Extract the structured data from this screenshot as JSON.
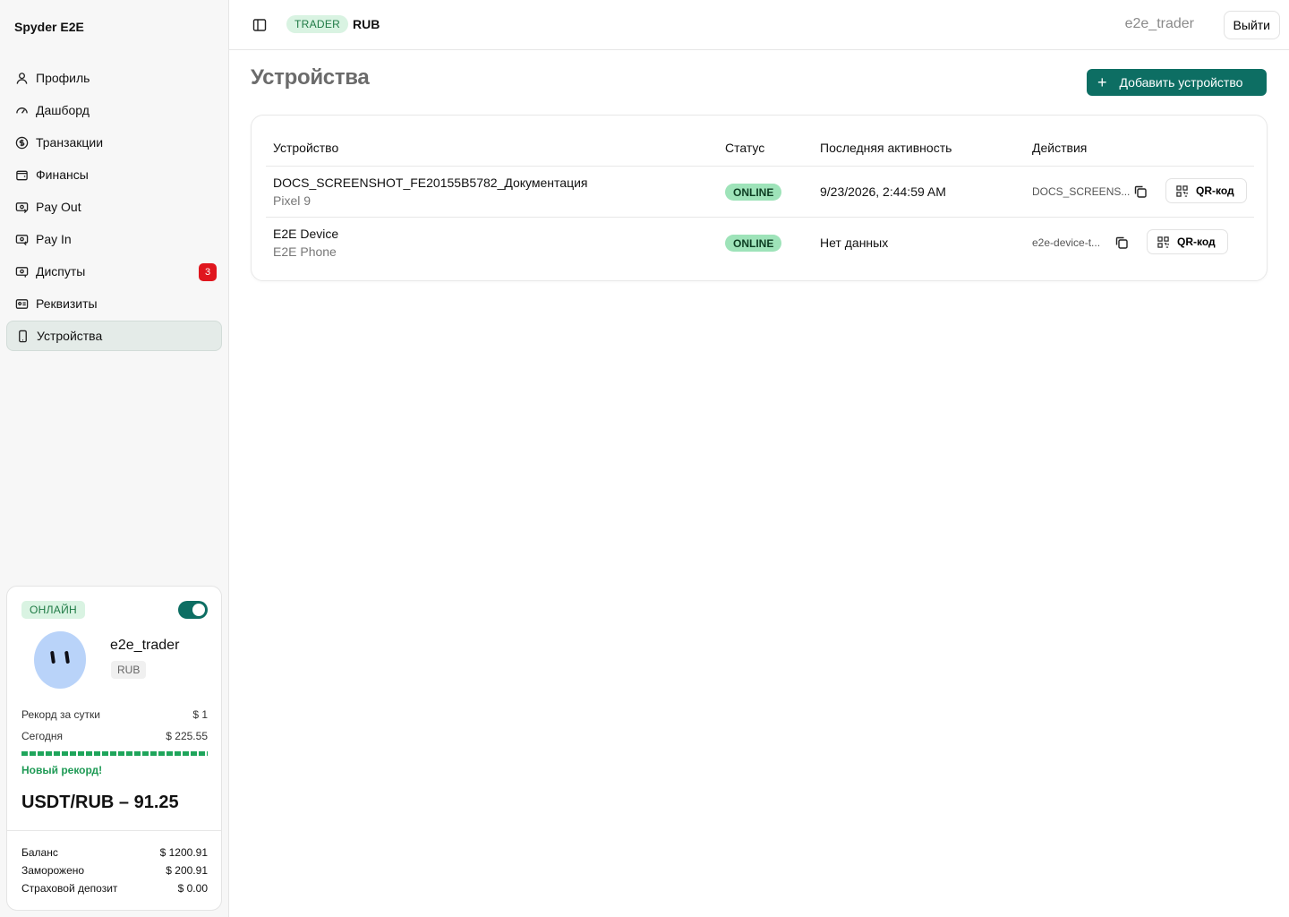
{
  "app": {
    "brand": "Spyder E2E"
  },
  "sidebar": {
    "items": [
      {
        "label": "Профиль",
        "icon": "user-icon"
      },
      {
        "label": "Дашборд",
        "icon": "gauge-icon"
      },
      {
        "label": "Транзакции",
        "icon": "dollar-circle-icon"
      },
      {
        "label": "Финансы",
        "icon": "wallet-icon"
      },
      {
        "label": "Pay Out",
        "icon": "payout-icon"
      },
      {
        "label": "Pay In",
        "icon": "payin-icon"
      },
      {
        "label": "Диспуты",
        "icon": "dispute-icon",
        "badge": "3"
      },
      {
        "label": "Реквизиты",
        "icon": "id-card-icon"
      },
      {
        "label": "Устройства",
        "icon": "smartphone-icon",
        "active": true
      }
    ]
  },
  "user_card": {
    "status": "ОНЛАЙН",
    "online_toggle": true,
    "username": "e2e_trader",
    "currency": "RUB",
    "record_label": "Рекорд за сутки",
    "record_value": "$ 1",
    "today_label": "Сегодня",
    "today_value": "$ 225.55",
    "record_progress": 1.0,
    "new_record": "Новый рекорд!",
    "rate": "USDT/RUB – 91.25",
    "balance_label": "Баланс",
    "balance_value": "$ 1200.91",
    "frozen_label": "Заморожено",
    "frozen_value": "$ 200.91",
    "deposit_label": "Страховой депозит",
    "deposit_value": "$ 0.00"
  },
  "topbar": {
    "role": "TRADER",
    "currency": "RUB",
    "username": "e2e_trader",
    "logout_label": "Выйти"
  },
  "main": {
    "title": "Устройства",
    "add_button": "Добавить устройство",
    "table": {
      "headers": [
        "Устройство",
        "Статус",
        "Последняя активность",
        "Действия"
      ],
      "rows": [
        {
          "name": "DOCS_SCREENSHOT_FE20155B5782_Документация",
          "model": "Pixel 9",
          "status": "ONLINE",
          "last_activity": "9/23/2026, 2:44:59 AM",
          "device_id": "DOCS_SCREENS...",
          "qr_label": "QR-код"
        },
        {
          "name": "E2E Device",
          "model": "E2E Phone",
          "status": "ONLINE",
          "last_activity": "Нет данных",
          "device_id": "e2e-device-t...",
          "qr_label": "QR-код"
        }
      ]
    }
  },
  "colors": {
    "accent": "#0d6e63",
    "online_bg": "#9ee3b9",
    "badge_red": "#e0161e",
    "progress_green": "#1ea55b"
  }
}
